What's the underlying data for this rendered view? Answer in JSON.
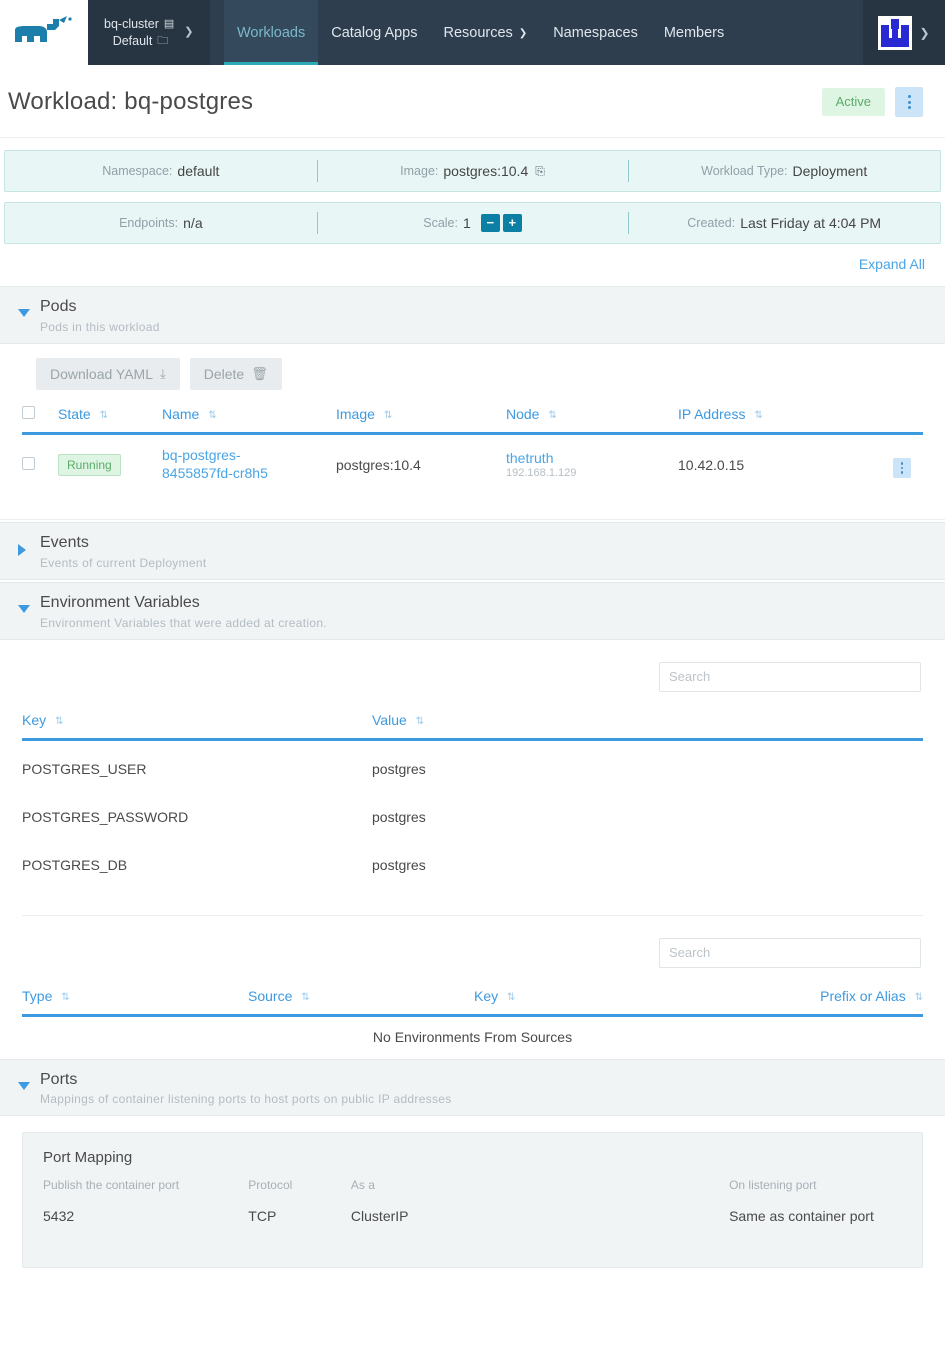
{
  "header": {
    "logo_name": "rancher-cow-logo",
    "cluster": "bq-cluster",
    "project": "Default",
    "nav": [
      {
        "label": "Workloads",
        "active": true,
        "caret": false
      },
      {
        "label": "Catalog Apps",
        "active": false,
        "caret": false
      },
      {
        "label": "Resources",
        "active": false,
        "caret": true
      },
      {
        "label": "Namespaces",
        "active": false,
        "caret": false
      },
      {
        "label": "Members",
        "active": false,
        "caret": false
      }
    ],
    "caret_glyph": "⌄"
  },
  "page": {
    "title": "Workload: bq-postgres",
    "status_badge": "Active",
    "expand_all": "Expand All"
  },
  "info": {
    "row1": [
      {
        "label": "Namespace:",
        "value": "default",
        "icon": ""
      },
      {
        "label": "Image:",
        "value": "postgres:10.4",
        "icon": "📋"
      },
      {
        "label": "Workload Type:",
        "value": "Deployment",
        "icon": ""
      }
    ],
    "row2": {
      "endpoints_label": "Endpoints:",
      "endpoints_value": "n/a",
      "scale_label": "Scale:",
      "scale_value": "1",
      "scale_minus": "−",
      "scale_plus": "+",
      "created_label": "Created:",
      "created_value": "Last Friday at 4:04 PM"
    }
  },
  "sections": {
    "pods": {
      "title": "Pods",
      "subtitle": "Pods in this workload",
      "expanded": true,
      "toolbar": {
        "download_yaml": "Download YAML",
        "download_icon": "⤓",
        "delete": "Delete",
        "delete_icon": "🗑"
      },
      "columns": [
        "State",
        "Name",
        "Image",
        "Node",
        "IP Address"
      ],
      "rows": [
        {
          "state": "Running",
          "name": "bq-postgres-8455857fd-cr8h5",
          "image": "postgres:10.4",
          "node": "thetruth",
          "node_ip": "192.168.1.129",
          "ip_address": "10.42.0.15"
        }
      ]
    },
    "events": {
      "title": "Events",
      "subtitle": "Events of current Deployment",
      "expanded": false
    },
    "env": {
      "title": "Environment Variables",
      "subtitle": "Environment Variables that were added at creation.",
      "expanded": true,
      "search_placeholder": "Search",
      "columns": [
        "Key",
        "Value"
      ],
      "rows": [
        {
          "key": "POSTGRES_USER",
          "value": "postgres"
        },
        {
          "key": "POSTGRES_PASSWORD",
          "value": "postgres"
        },
        {
          "key": "POSTGRES_DB",
          "value": "postgres"
        }
      ],
      "sources": {
        "search_placeholder": "Search",
        "columns": [
          "Type",
          "Source",
          "Key",
          "Prefix or Alias"
        ],
        "empty_text": "No Environments From Sources"
      }
    },
    "ports": {
      "title": "Ports",
      "subtitle": "Mappings of container listening ports to host ports on public IP addresses",
      "expanded": true,
      "card_title": "Port Mapping",
      "columns": [
        "Publish the container port",
        "Protocol",
        "As a",
        "On listening port"
      ],
      "rows": [
        {
          "container_port": "5432",
          "protocol": "TCP",
          "as_a": "ClusterIP",
          "listening_port": "Same as container port"
        }
      ]
    }
  },
  "colors": {
    "header_bg": "#2e3e4e",
    "accent_blue": "#3d9ae0",
    "link_blue": "#49a5e6",
    "banner_bg": "#e9f6f6",
    "status_green_bg": "#dff5e4",
    "status_green_text": "#5aab69",
    "teal_underline": "#2daab5"
  },
  "sort_glyph": "⇅"
}
